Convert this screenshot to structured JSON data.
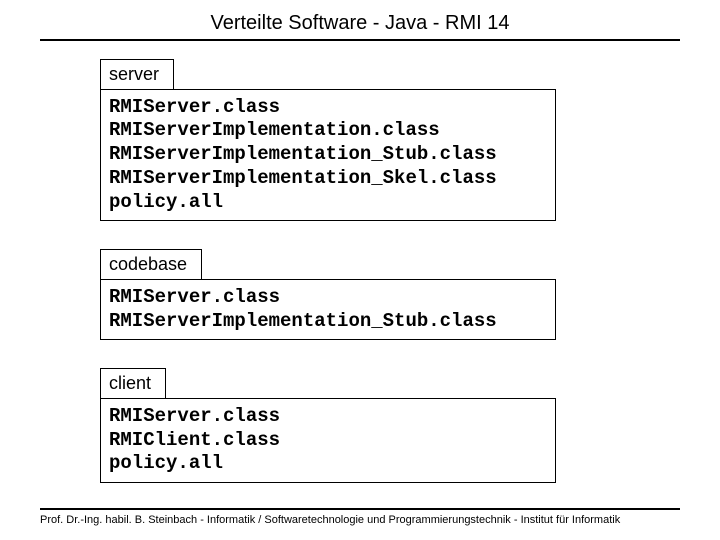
{
  "title": "Verteilte Software - Java - RMI 14",
  "groups": [
    {
      "label": "server",
      "files": [
        "RMIServer.class",
        "RMIServerImplementation.class",
        "RMIServerImplementation_Stub.class",
        "RMIServerImplementation_Skel.class",
        "policy.all"
      ]
    },
    {
      "label": "codebase",
      "files": [
        "RMIServer.class",
        "RMIServerImplementation_Stub.class"
      ]
    },
    {
      "label": "client",
      "files": [
        "RMIServer.class",
        "RMIClient.class",
        "policy.all"
      ]
    }
  ],
  "footer": "Prof. Dr.-Ing. habil. B. Steinbach - Informatik / Softwaretechnologie und Programmierungstechnik - Institut für Informatik"
}
